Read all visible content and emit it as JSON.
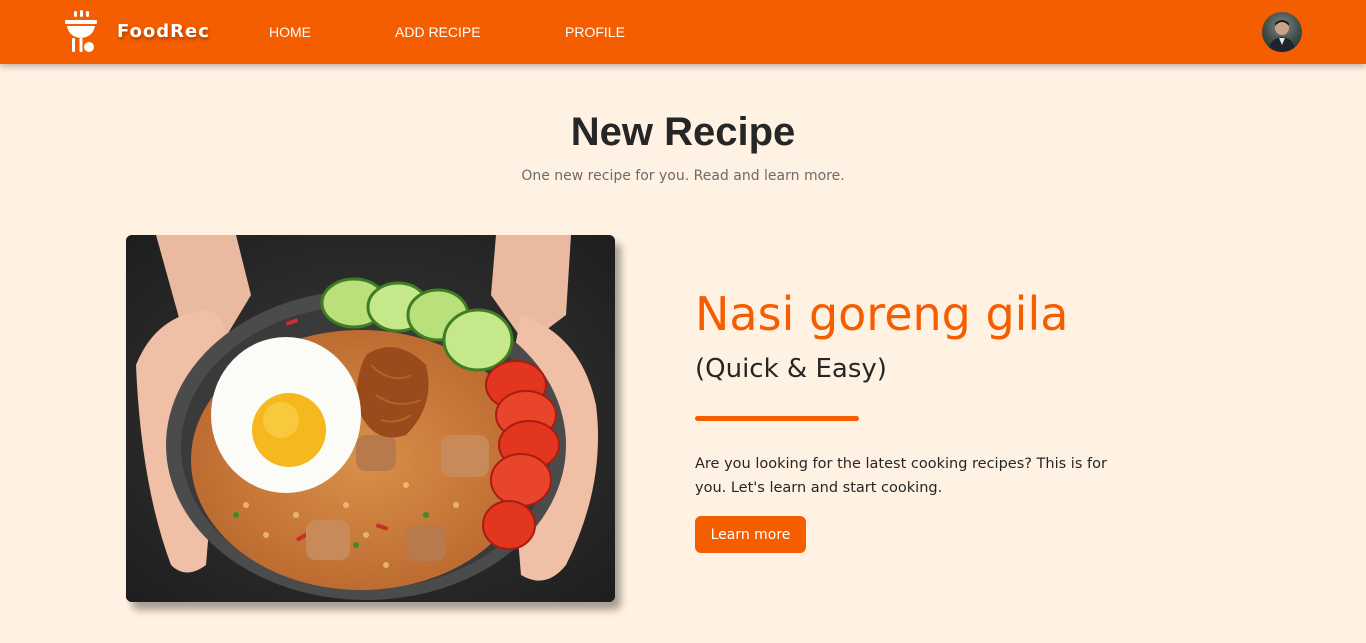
{
  "navbar": {
    "brand": "FoodRec",
    "links": [
      "HOME",
      "ADD RECIPE",
      "PROFILE"
    ],
    "logo_icon": "grill-icon",
    "avatar_icon": "user-avatar"
  },
  "hero": {
    "title": "New Recipe",
    "subtitle": "One new recipe for you. Read and learn more."
  },
  "recipe": {
    "name": "Nasi goreng gila",
    "tag": "(Quick & Easy)",
    "description": "Are you looking for the latest cooking recipes? This is for you. Let's learn and start cooking.",
    "button_label": "Learn more",
    "image_icon": "food-photo"
  },
  "colors": {
    "accent": "#f45d00",
    "background": "#fff2e2",
    "text": "#262626",
    "muted": "#6b6b6b"
  }
}
